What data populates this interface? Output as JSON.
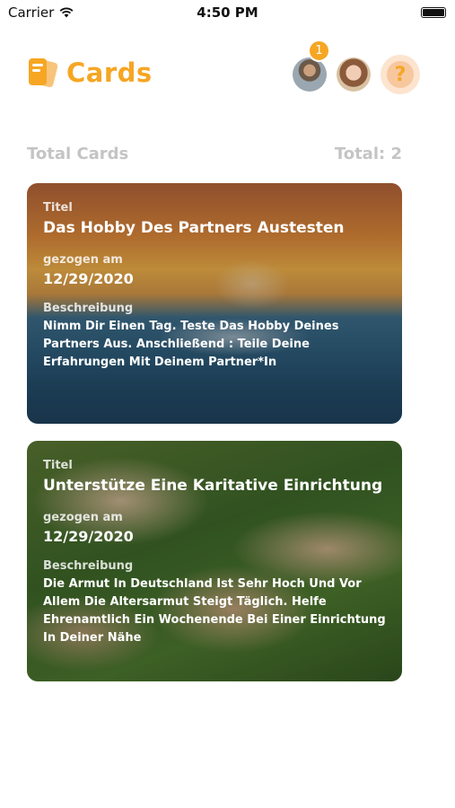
{
  "status_bar": {
    "carrier": "Carrier",
    "time": "4:50 PM",
    "battery_level": 1.0
  },
  "header": {
    "app_name": "Cards",
    "notification_count": "1",
    "help_label": "?",
    "accent_color": "#f6a623"
  },
  "totals": {
    "label": "Total Cards",
    "total": "Total: 2"
  },
  "cards": [
    {
      "title_label": "Titel",
      "title": "Das Hobby Des Partners Austesten",
      "date_label": "gezogen am",
      "date": "12/29/2020",
      "description_label": "Beschreibung",
      "description": "Nimm Dir Einen Tag. Teste Das Hobby Deines Partners Aus. Anschließend : Teile Deine Erfahrungen Mit Deinem Partner*In"
    },
    {
      "title_label": "Titel",
      "title": "Unterstütze Eine Karitative Einrichtung",
      "date_label": "gezogen am",
      "date": "12/29/2020",
      "description_label": "Beschreibung",
      "description": "Die Armut In Deutschland Ist Sehr Hoch Und Vor Allem Die Altersarmut Steigt Täglich. Helfe Ehrenamtlich Ein Wochenende Bei Einer Einrichtung In Deiner Nähe"
    }
  ]
}
